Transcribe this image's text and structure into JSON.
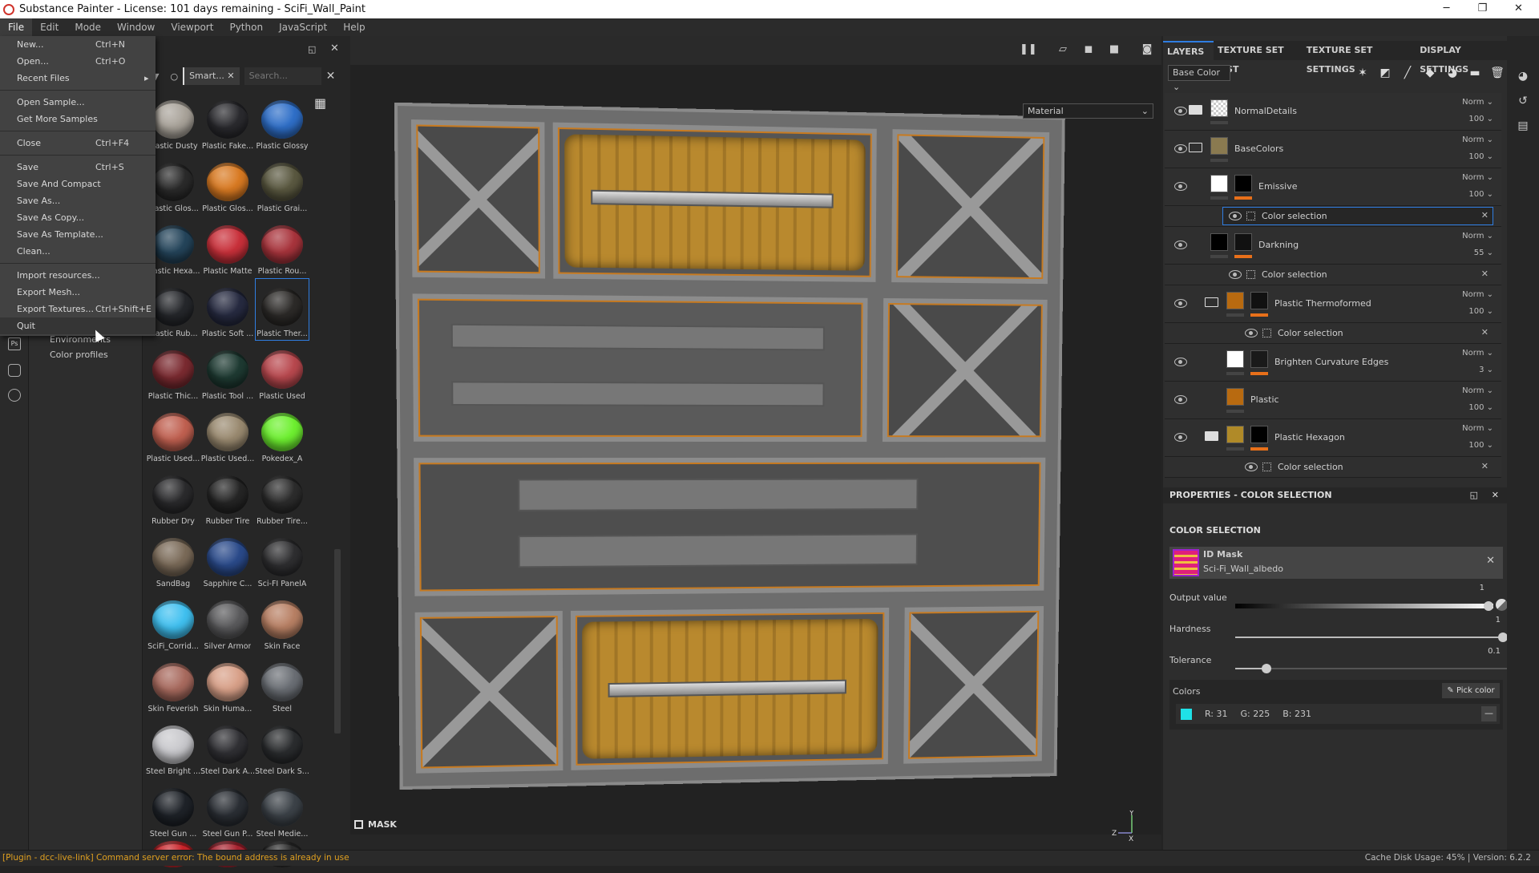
{
  "window": {
    "title": "Substance Painter - License: 101 days remaining - SciFi_Wall_Paint",
    "minimize": "─",
    "maximize": "❐",
    "close": "✕"
  },
  "menubar": [
    "File",
    "Edit",
    "Mode",
    "Window",
    "Viewport",
    "Python",
    "JavaScript",
    "Help"
  ],
  "file_menu": [
    {
      "label": "New...",
      "shortcut": "Ctrl+N"
    },
    {
      "label": "Open...",
      "shortcut": "Ctrl+O"
    },
    {
      "label": "Recent Files",
      "shortcut": "▸"
    },
    {
      "sep": true
    },
    {
      "label": "Open Sample...",
      "shortcut": ""
    },
    {
      "label": "Get More Samples",
      "shortcut": ""
    },
    {
      "sep": true
    },
    {
      "label": "Close",
      "shortcut": "Ctrl+F4"
    },
    {
      "sep": true
    },
    {
      "label": "Save",
      "shortcut": "Ctrl+S"
    },
    {
      "label": "Save And Compact",
      "shortcut": ""
    },
    {
      "label": "Save As...",
      "shortcut": ""
    },
    {
      "label": "Save As Copy...",
      "shortcut": ""
    },
    {
      "label": "Save As Template...",
      "shortcut": ""
    },
    {
      "label": "Clean...",
      "shortcut": ""
    },
    {
      "sep": true
    },
    {
      "label": "Import resources...",
      "shortcut": ""
    },
    {
      "label": "Export Mesh...",
      "shortcut": ""
    },
    {
      "label": "Export Textures...",
      "shortcut": "Ctrl+Shift+E"
    },
    {
      "label": "Quit",
      "shortcut": "",
      "highlighted": true
    }
  ],
  "shelf_nav": {
    "items": [
      "Environments",
      "Color profiles"
    ]
  },
  "icon_strip": {
    "ps": "Ps"
  },
  "shelf": {
    "filter_chip": "Smart...",
    "search_placeholder": "Search...",
    "materials": [
      {
        "name": "Plastic Dusty",
        "color": "#a9a39a"
      },
      {
        "name": "Plastic Fake...",
        "color": "#2a2a2e"
      },
      {
        "name": "Plastic Glossy",
        "color": "#2f6fc8"
      },
      {
        "name": "Plastic Glos...",
        "color": "#2a2a2a"
      },
      {
        "name": "Plastic Glos...",
        "color": "#d97a22"
      },
      {
        "name": "Plastic Grai...",
        "color": "#5a5840"
      },
      {
        "name": "Plastic Hexa...",
        "color": "#24445a"
      },
      {
        "name": "Plastic Matte",
        "color": "#c9303a"
      },
      {
        "name": "Plastic Rou...",
        "color": "#a8343c"
      },
      {
        "name": "Plastic Rub...",
        "color": "#25272b"
      },
      {
        "name": "Plastic Soft ...",
        "color": "#262a40"
      },
      {
        "name": "Plastic Ther...",
        "color": "#2c2a28",
        "selected": true
      },
      {
        "name": "Plastic Thic...",
        "color": "#7a2a30"
      },
      {
        "name": "Plastic Tool ...",
        "color": "#1e3a32"
      },
      {
        "name": "Plastic Used",
        "color": "#b8484e"
      },
      {
        "name": "Plastic Used...",
        "color": "#c06050"
      },
      {
        "name": "Plastic Used...",
        "color": "#9a8a70"
      },
      {
        "name": "Pokedex_A",
        "color": "#6ef030"
      },
      {
        "name": "Rubber Dry",
        "color": "#2a2a2c"
      },
      {
        "name": "Rubber Tire",
        "color": "#252525"
      },
      {
        "name": "Rubber Tire...",
        "color": "#2c2c2c"
      },
      {
        "name": "SandBag",
        "color": "#7a6a58"
      },
      {
        "name": "Sapphire C...",
        "color": "#2a4a8a"
      },
      {
        "name": "Sci-FI PanelA",
        "color": "#2e2e30"
      },
      {
        "name": "SciFi_Corrid...",
        "color": "#40c0f0"
      },
      {
        "name": "Silver Armor",
        "color": "#5a5a5c"
      },
      {
        "name": "Skin Face",
        "color": "#b88064"
      },
      {
        "name": "Skin Feverish",
        "color": "#a86a5e"
      },
      {
        "name": "Skin Huma...",
        "color": "#d8a088"
      },
      {
        "name": "Steel",
        "color": "#6a6e74"
      },
      {
        "name": "Steel Bright ...",
        "color": "#c8c8cc"
      },
      {
        "name": "Steel Dark A...",
        "color": "#303034"
      },
      {
        "name": "Steel Dark S...",
        "color": "#2a2c2e"
      },
      {
        "name": "Steel Gun ...",
        "color": "#1e2228"
      },
      {
        "name": "Steel Gun P...",
        "color": "#2a2e34"
      },
      {
        "name": "Steel Medie...",
        "color": "#3c4248"
      },
      {
        "name": "",
        "color": "#c8242a"
      },
      {
        "name": "",
        "color": "#a82430"
      },
      {
        "name": "",
        "color": "#2c2c2c"
      }
    ]
  },
  "viewport": {
    "display_mode": "Material",
    "mask_label": "MASK",
    "axis": {
      "x": "X",
      "y": "Y",
      "z": "Z"
    }
  },
  "layers_panel": {
    "tabs": [
      "LAYERS",
      "TEXTURE SET LIST",
      "TEXTURE SET SETTINGS",
      "DISPLAY SETTINGS"
    ],
    "channel": "Base Color",
    "layers": [
      {
        "type": "layer",
        "name": "NormalDetails",
        "folder": "closed",
        "indent": 0,
        "thumb": "#e8e8e8",
        "checker": true,
        "mask": null,
        "blend": "Norm",
        "opacity": "100"
      },
      {
        "type": "layer",
        "name": "BaseColors",
        "folder": "open",
        "indent": 0,
        "thumb": "#8a7a50",
        "mask": null,
        "blend": "Norm",
        "opacity": "100"
      },
      {
        "type": "layer",
        "name": "Emissive",
        "folder": null,
        "indent": 1,
        "thumb": "#ffffff",
        "mask": "#000000",
        "blend": "Norm",
        "opacity": "100"
      },
      {
        "type": "effect",
        "name": "Color selection",
        "indent": 1,
        "selected": true
      },
      {
        "type": "layer",
        "name": "Darkning",
        "folder": null,
        "indent": 1,
        "thumb": "#000000",
        "mask": "#111111",
        "blend": "Norm",
        "opacity": "55"
      },
      {
        "type": "effect",
        "name": "Color selection",
        "indent": 1
      },
      {
        "type": "layer",
        "name": "Plastic Thermoformed",
        "folder": "open",
        "indent": 1,
        "thumb": "#b86a10",
        "mask": "#111111",
        "blend": "Norm",
        "opacity": "100"
      },
      {
        "type": "effect",
        "name": "Color selection",
        "indent": 2
      },
      {
        "type": "layer",
        "name": "Brighten Curvature Edges",
        "folder": null,
        "indent": 2,
        "thumb": "#ffffff",
        "mask": "#1a1a1a",
        "blend": "Norm",
        "opacity": "3"
      },
      {
        "type": "layer",
        "name": "Plastic",
        "folder": null,
        "indent": 2,
        "thumb": "#b86a10",
        "mask": null,
        "blend": "Norm",
        "opacity": "100"
      },
      {
        "type": "layer",
        "name": "Plastic Hexagon",
        "folder": "closed",
        "indent": 1,
        "thumb": "#b08a28",
        "mask": "#000000",
        "blend": "Norm",
        "opacity": "100"
      },
      {
        "type": "effect",
        "name": "Color selection",
        "indent": 2
      }
    ]
  },
  "properties": {
    "header": "PROPERTIES - COLOR SELECTION",
    "section": "COLOR SELECTION",
    "id_mask": {
      "title": "ID Mask",
      "source": "Sci-Fi_Wall_albedo"
    },
    "output_value": {
      "label": "Output value",
      "value": "1",
      "fraction": 1
    },
    "hardness": {
      "label": "Hardness",
      "value": "1",
      "fraction": 1
    },
    "tolerance": {
      "label": "Tolerance",
      "value": "0.1",
      "fraction": 0.1
    },
    "colors": {
      "label": "Colors",
      "pick_label": "Pick color",
      "swatch": "#1fe1e7",
      "r": "R: 31",
      "g": "G: 225",
      "b": "B: 231"
    }
  },
  "statusbar": {
    "error": "[Plugin - dcc-live-link] Command server error: The bound address is already in use",
    "cache": "Cache Disk Usage:   45% | Version: 6.2.2"
  },
  "colors": {
    "accent": "#2f7de1",
    "orange": "#e8701a",
    "warning": "#e0a020"
  }
}
